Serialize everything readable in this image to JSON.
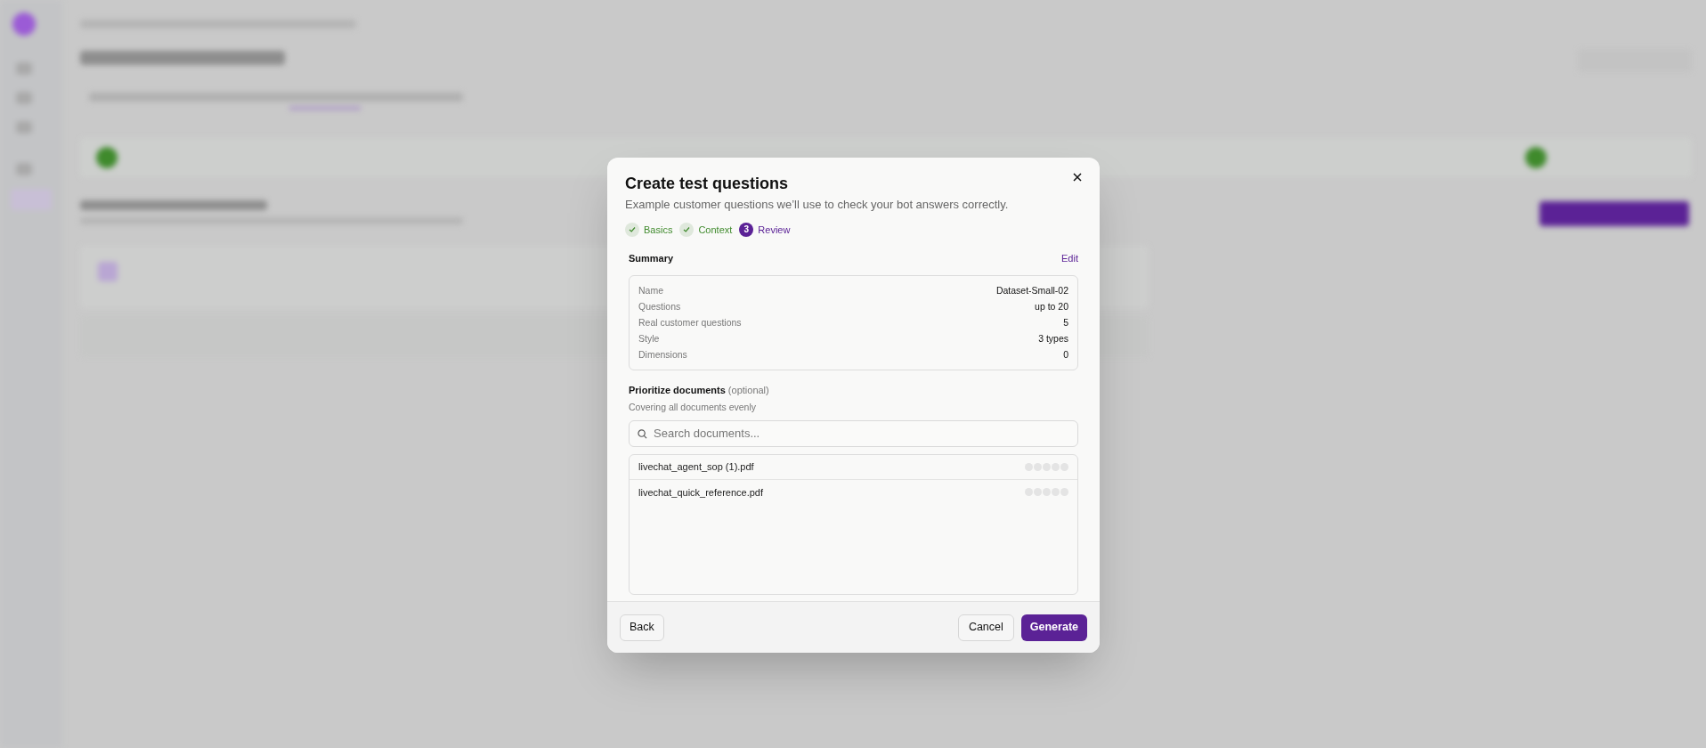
{
  "dialog": {
    "title": "Create test questions",
    "subtitle": "Example customer questions we’ll use to check your bot answers correctly.",
    "steps": [
      {
        "label": "Basics",
        "completed": true,
        "selected": false
      },
      {
        "label": "Context",
        "completed": true,
        "selected": false
      },
      {
        "label": "Review",
        "number": "3",
        "completed": false,
        "selected": true
      }
    ],
    "summary": {
      "heading": "Summary",
      "edit_link": "Edit",
      "rows": [
        {
          "label": "Name",
          "value": "Dataset-Small-02"
        },
        {
          "label": "Questions",
          "value": "up to 20"
        },
        {
          "label": "Real customer questions",
          "value": "5"
        },
        {
          "label": "Style",
          "value": "3 types"
        },
        {
          "label": "Dimensions",
          "value": "0"
        }
      ]
    },
    "prioritize": {
      "heading": "Prioritize documents",
      "note": "(optional)",
      "hint": "Covering all documents evenly",
      "search": {
        "placeholder": "Search documents..."
      },
      "documents": [
        {
          "name": "livechat_agent_sop (1).pdf",
          "stars": 0
        },
        {
          "name": "livechat_quick_reference.pdf",
          "stars": 0
        }
      ]
    },
    "buttons": {
      "back": "Back",
      "cancel": "Cancel",
      "generate": "Generate"
    }
  }
}
